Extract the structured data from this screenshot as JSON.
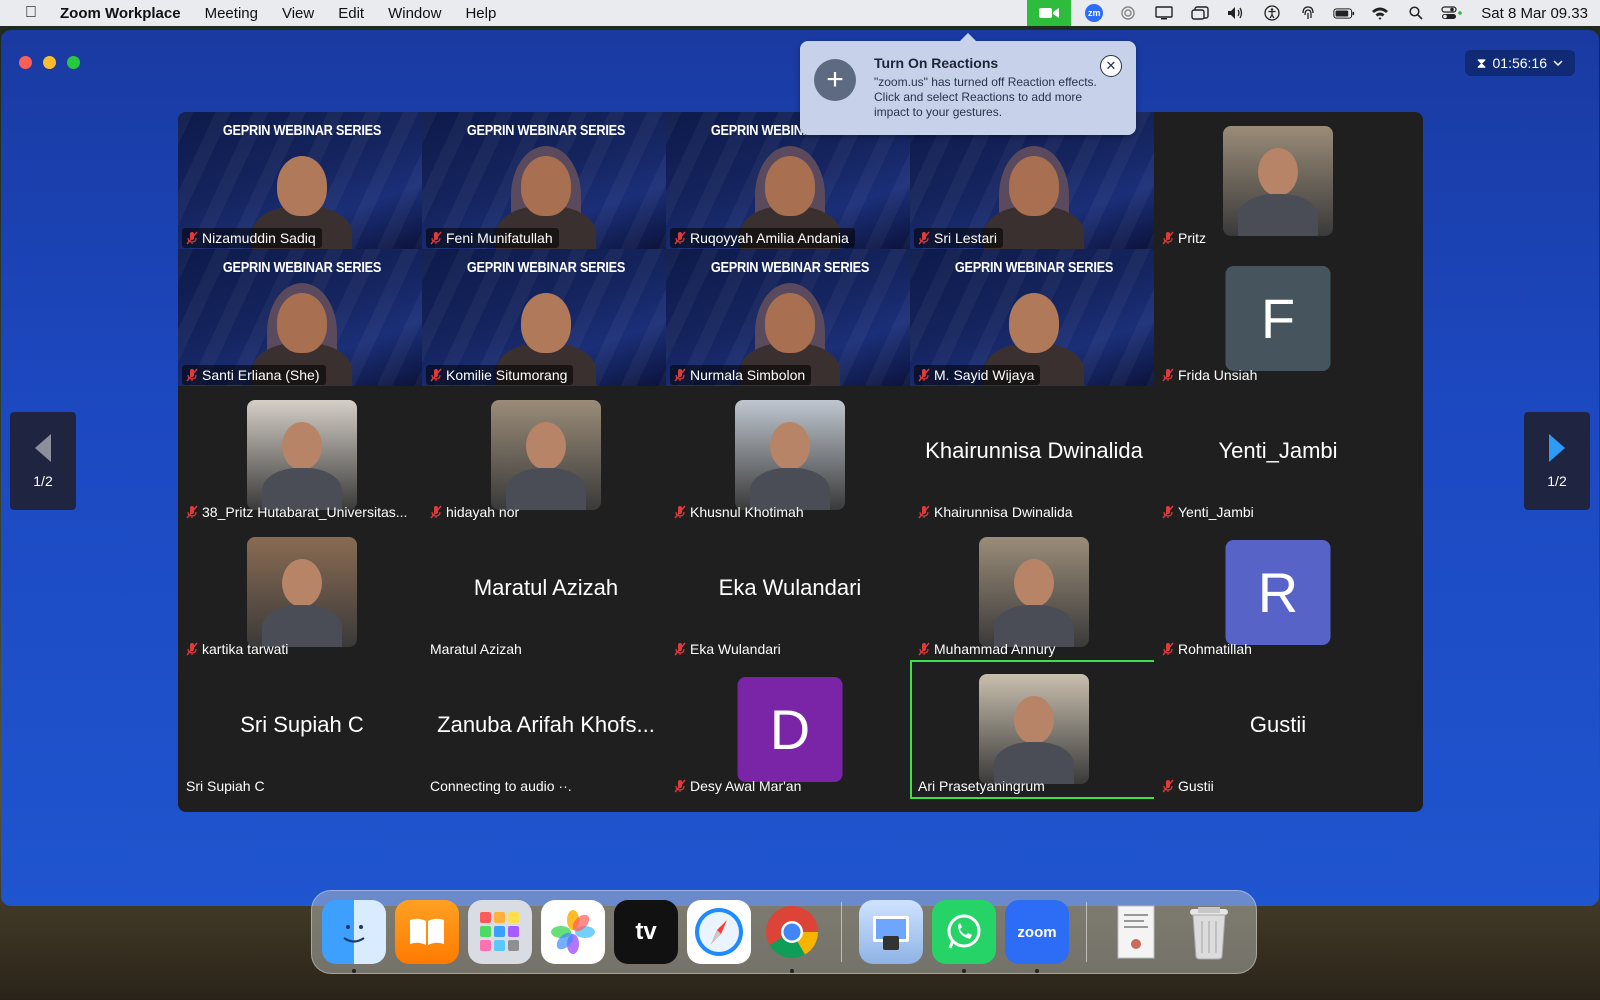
{
  "menubar": {
    "app_name": "Zoom Workplace",
    "menus": [
      "Meeting",
      "View",
      "Edit",
      "Window",
      "Help"
    ],
    "zm_label": "zm",
    "clock": "Sat 8 Mar  09.33"
  },
  "window": {
    "timer": "01:56:16",
    "pager_left": "1/2",
    "pager_right": "1/2"
  },
  "reactions_popup": {
    "title": "Turn On Reactions",
    "body": "\"zoom.us\" has turned off Reaction effects. Click  and select Reactions to add more impact to your gestures.",
    "close_label": "✕"
  },
  "banner": "GEPRIN WEBINAR SERIES",
  "participants": [
    {
      "name": "Nizamuddin Sadiq",
      "type": "video"
    },
    {
      "name": "Feni Munifatullah",
      "type": "video"
    },
    {
      "name": "Ruqoyyah Amilia Andania",
      "type": "video"
    },
    {
      "name": "Sri Lestari",
      "type": "video"
    },
    {
      "name": "Pritz",
      "type": "photo"
    },
    {
      "name": "Santi Erliana (She)",
      "type": "video"
    },
    {
      "name": "Komilie Situmorang",
      "type": "video"
    },
    {
      "name": "Nurmala Simbolon",
      "type": "video"
    },
    {
      "name": "M. Sayid Wijaya",
      "type": "video"
    },
    {
      "name": "Frida Unsiah",
      "type": "letter",
      "letter": "F",
      "color": "#46545e"
    },
    {
      "name": "38_Pritz Hutabarat_Universitas...",
      "type": "photo"
    },
    {
      "name": "hidayah nor",
      "type": "photo"
    },
    {
      "name": "Khusnul Khotimah",
      "type": "photo"
    },
    {
      "name": "Khairunnisa Dwinalida",
      "type": "name",
      "big": "Khairunnisa Dwinalida"
    },
    {
      "name": "Yenti_Jambi",
      "type": "name",
      "big": "Yenti_Jambi"
    },
    {
      "name": "kartika tarwati",
      "type": "photo"
    },
    {
      "name": "Maratul Azizah",
      "type": "name",
      "big": "Maratul Azizah"
    },
    {
      "name": "Eka Wulandari",
      "type": "name",
      "big": "Eka Wulandari"
    },
    {
      "name": "Muhammad Annury",
      "type": "photo"
    },
    {
      "name": "Rohmatillah",
      "type": "letter",
      "letter": "R",
      "color": "#5763c6"
    },
    {
      "name": "Sri Supiah C",
      "type": "name",
      "big": "Sri Supiah C"
    },
    {
      "name": "Connecting to audio  ··.",
      "type": "name",
      "big": "Zanuba Arifah Khofs..."
    },
    {
      "name": "Desy Awal Mar'an",
      "type": "letter",
      "letter": "D",
      "color": "#7a24a8"
    },
    {
      "name": "Ari Prasetyaningrum",
      "type": "photo"
    },
    {
      "name": "Gustii",
      "type": "name",
      "big": "Gustii"
    }
  ],
  "icons": {
    "apple": "apple-logo-icon",
    "camera": "zoom-camera-icon",
    "hourglass": "⧗"
  },
  "dock": {
    "zoom_label": "zoom",
    "tv_label": "tv"
  }
}
